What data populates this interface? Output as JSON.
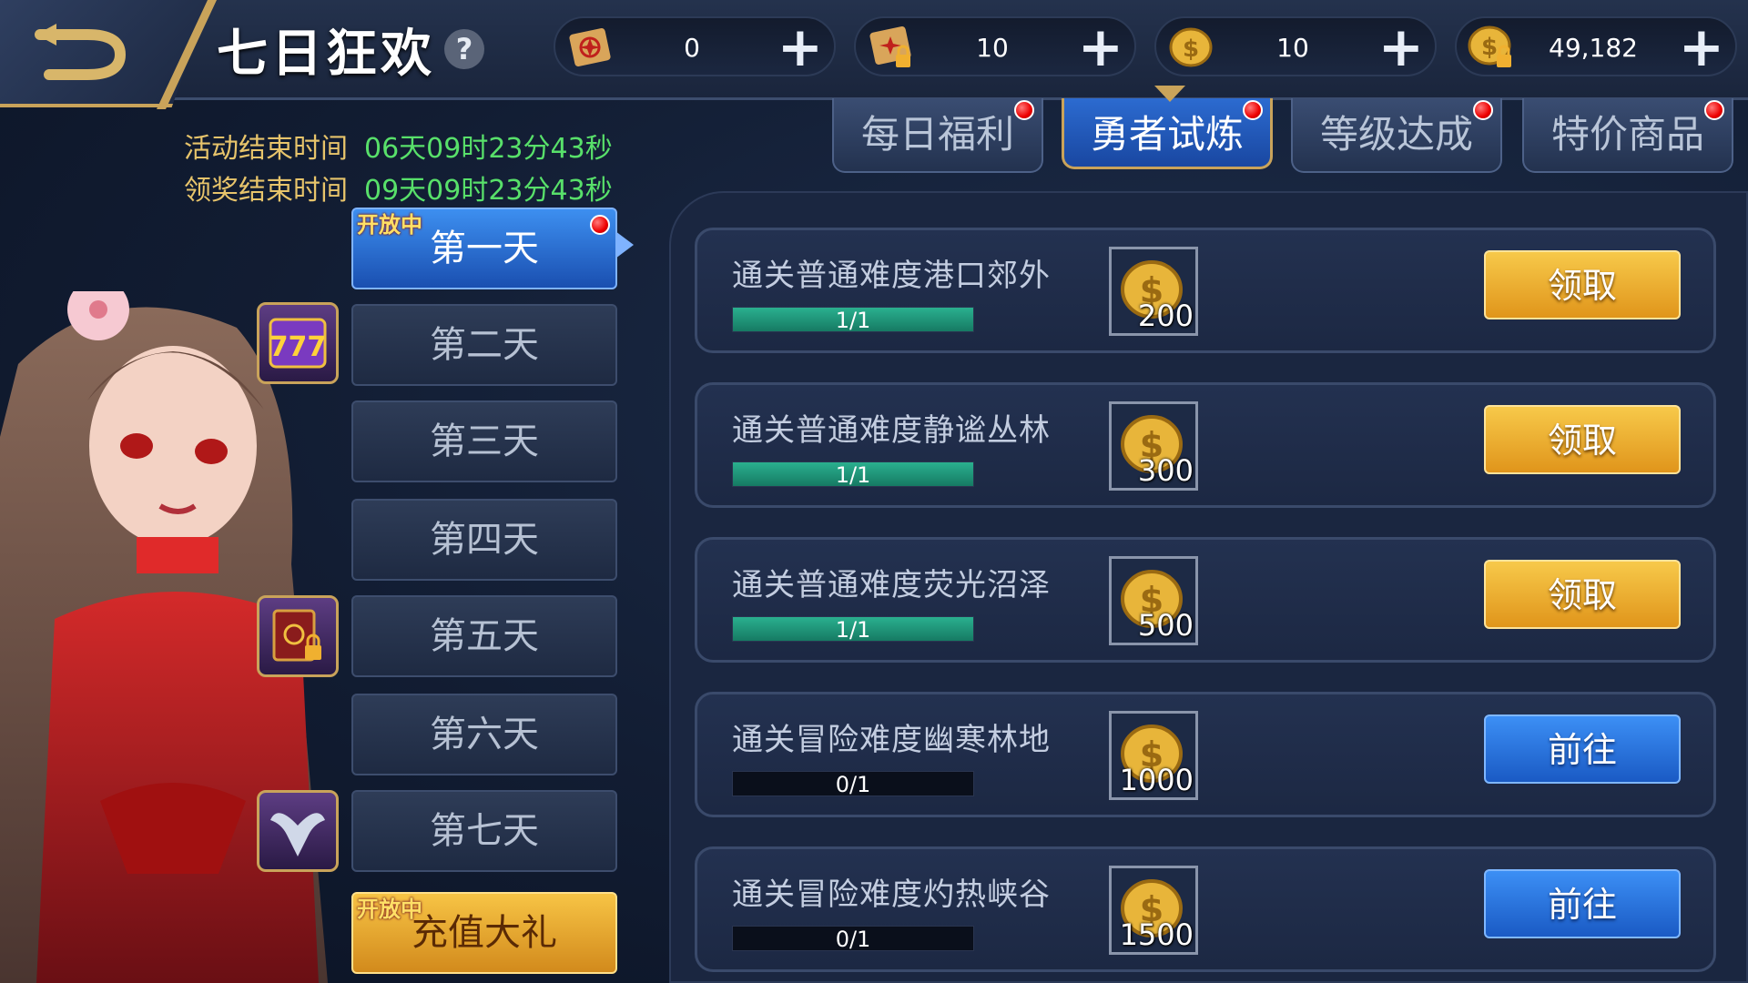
{
  "header": {
    "title": "七日狂欢",
    "help_symbol": "?",
    "resources": [
      {
        "icon": "scroll-icon",
        "value": "0"
      },
      {
        "icon": "locked-scroll-icon",
        "value": "10"
      },
      {
        "icon": "coin-icon",
        "value": "10"
      },
      {
        "icon": "locked-coin-icon",
        "value": "49,182"
      }
    ],
    "plus_symbol": "+"
  },
  "timers": {
    "event_end_label": "活动结束时间",
    "event_end_value": "06天09时23分43秒",
    "claim_end_label": "领奖结束时间",
    "claim_end_value": "09天09时23分43秒"
  },
  "tabs": [
    {
      "label": "每日福利",
      "active": false
    },
    {
      "label": "勇者试炼",
      "active": true
    },
    {
      "label": "等级达成",
      "active": false
    },
    {
      "label": "特价商品",
      "active": false
    }
  ],
  "days": [
    {
      "label": "第一天",
      "tag": "开放中"
    },
    {
      "label": "第二天"
    },
    {
      "label": "第三天"
    },
    {
      "label": "第四天"
    },
    {
      "label": "第五天"
    },
    {
      "label": "第六天"
    },
    {
      "label": "第七天"
    },
    {
      "label": "充值大礼",
      "tag": "开放中"
    }
  ],
  "side_icons": [
    "slot-machine-icon",
    "locked-book-icon",
    "wings-icon"
  ],
  "quests": [
    {
      "name": "通关普通难度港口郊外",
      "progress": "1/1",
      "progress_fraction": 1,
      "reward": "200",
      "button": "领取"
    },
    {
      "name": "通关普通难度静谧丛林",
      "progress": "1/1",
      "progress_fraction": 1,
      "reward": "300",
      "button": "领取"
    },
    {
      "name": "通关普通难度荧光沼泽",
      "progress": "1/1",
      "progress_fraction": 1,
      "reward": "500",
      "button": "领取"
    },
    {
      "name": "通关冒险难度幽寒林地",
      "progress": "0/1",
      "progress_fraction": 0,
      "reward": "1000",
      "button": "前往"
    },
    {
      "name": "通关冒险难度灼热峡谷",
      "progress": "0/1",
      "progress_fraction": 0,
      "reward": "1500",
      "button": "前往"
    }
  ],
  "colors": {
    "accent_gold": "#c9a35a",
    "timer_green": "#58e06a",
    "claim": "#f7c94a",
    "goto": "#3c8ff5"
  }
}
